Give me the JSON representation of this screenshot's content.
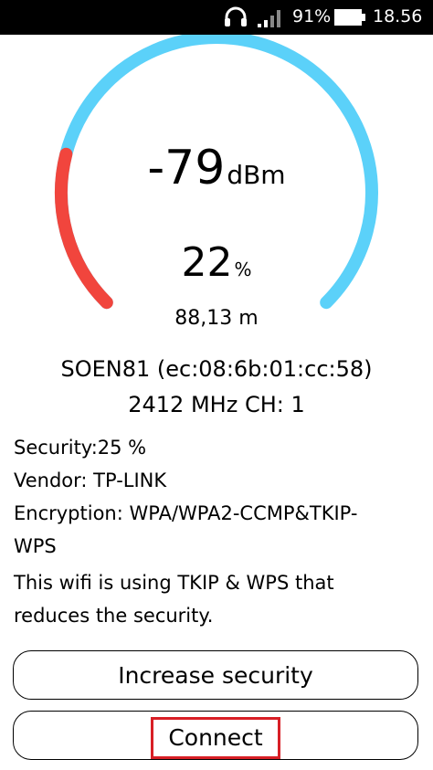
{
  "status_bar": {
    "battery_percent": "91%",
    "time": "18.56",
    "icons": [
      "headset-icon",
      "signal-bars-icon",
      "battery-icon"
    ]
  },
  "gauge": {
    "dbm": "-79",
    "dbm_unit": "dBm",
    "percent": "22",
    "percent_unit": "%",
    "distance": "88,13 m",
    "fill_fraction": 0.22,
    "track_color": "#5bd1f9",
    "fill_color": "#f1453d"
  },
  "network": {
    "name_mac": "SOEN81 (ec:08:6b:01:cc:58)",
    "freq_channel": "2412 MHz  CH: 1"
  },
  "details": {
    "security": "Security:25 %",
    "vendor": "Vendor: TP-LINK",
    "encryption_line1": "Encryption: WPA/WPA2-CCMP&TKIP-",
    "encryption_line2": "WPS",
    "warning_line1": "This wifi is using TKIP & WPS that",
    "warning_line2": "reduces the security."
  },
  "buttons": {
    "increase_security": "Increase security",
    "connect": "Connect"
  },
  "colors": {
    "highlight": "#d81f26"
  }
}
